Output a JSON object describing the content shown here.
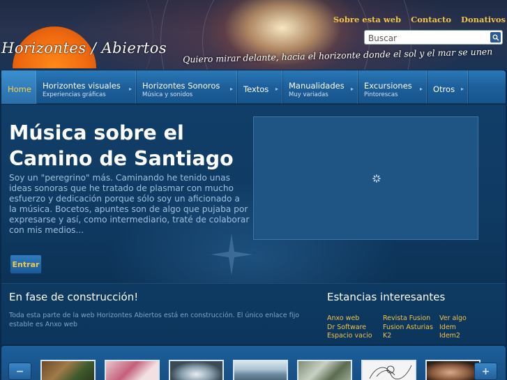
{
  "header": {
    "logo_text": "Horizontes / Abiertos",
    "tagline": "Quiero mirar delante, hacia el horizonte donde el sol y el mar se unen",
    "top_links": [
      "Sobre esta web",
      "Contacto",
      "Donativos"
    ],
    "search_placeholder": "Buscar"
  },
  "nav": {
    "items": [
      {
        "title": "Home",
        "sub": ""
      },
      {
        "title": "Horizontes visuales",
        "sub": "Experiencias gráficas"
      },
      {
        "title": "Horizontes Sonoros",
        "sub": "Música y sonidos"
      },
      {
        "title": "Textos",
        "sub": ""
      },
      {
        "title": "Manualidades",
        "sub": "Muy variadas"
      },
      {
        "title": "Excursiones",
        "sub": "Pintorescas"
      },
      {
        "title": "Otros",
        "sub": ""
      }
    ]
  },
  "hero": {
    "title": "Música sobre el Camino de Santiago",
    "body": "Soy un \"peregrino\" más. Caminando he tenido unas ideas sonoras que he tratado de plasmar con mucho esfuerzo y dedicación porque sólo soy un aficionado a la música. Bocetos, apuntes son de algo que pujaba por expresarse y así, como intermediario, traté de colaborar con mis medios...",
    "button": "Entrar"
  },
  "info": {
    "left_title": "En fase de construcción!",
    "left_text": "Toda esta parte de la web Horizontes Abiertos está en construcción. El único enlace fijo estable es Anxo web",
    "right_title": "Estancias interesantes",
    "links": [
      "Anxo web",
      "Revista Fusion",
      "Ver algo",
      "Dr Software",
      "Fusion Asturias",
      "Idem",
      "Espacio vacio",
      "K2",
      "Idem2"
    ]
  },
  "gallery": {
    "prev": "−",
    "next": "+"
  },
  "colors": {
    "accent": "#f0c44a",
    "nav_blue": "#1d5f9b",
    "panel_blue": "#0f3a62"
  }
}
